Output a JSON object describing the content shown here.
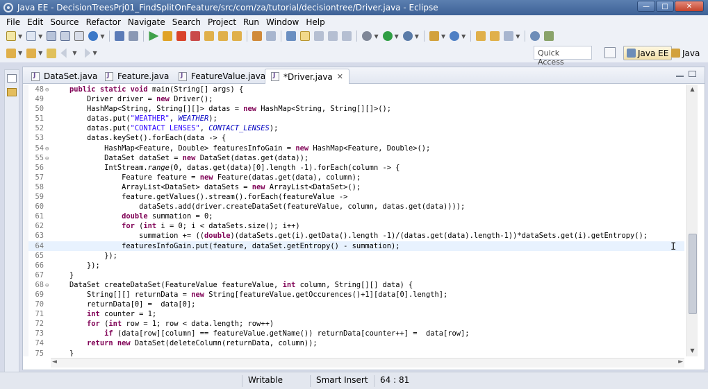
{
  "window": {
    "title": "Java EE - DecisionTreesPrj01_FindSplitOnFeature/src/com/za/tutorial/decisiontree/Driver.java - Eclipse",
    "minimize_label": "—",
    "maximize_label": "□",
    "close_label": "✕"
  },
  "menu": [
    "File",
    "Edit",
    "Source",
    "Refactor",
    "Navigate",
    "Search",
    "Project",
    "Run",
    "Window",
    "Help"
  ],
  "toolbar": {
    "quick_access_label": "Quick Access",
    "perspectives": [
      {
        "label": "Java EE",
        "active": true
      },
      {
        "label": "Java",
        "active": false
      }
    ]
  },
  "editor": {
    "tabs": [
      {
        "label": "DataSet.java",
        "active": false
      },
      {
        "label": "Feature.java",
        "active": false
      },
      {
        "label": "FeatureValue.java",
        "active": false
      },
      {
        "label": "*Driver.java",
        "active": true,
        "close_label": "✕"
      }
    ],
    "current_line": 64,
    "lines": [
      {
        "n": 48,
        "fold": "⊖",
        "code": "    public static void main(String[] args) {"
      },
      {
        "n": 49,
        "code": "        Driver driver = new Driver();"
      },
      {
        "n": 50,
        "code": "        HashMap<String, String[][]> datas = new HashMap<String, String[][]>();"
      },
      {
        "n": 51,
        "code": "        datas.put(\"WEATHER\", WEATHER);"
      },
      {
        "n": 52,
        "code": "        datas.put(\"CONTACT LENSES\", CONTACT_LENSES);"
      },
      {
        "n": 53,
        "code": "        datas.keySet().forEach(data -> {"
      },
      {
        "n": 54,
        "fold": "⊖",
        "code": "            HashMap<Feature, Double> featuresInfoGain = new HashMap<Feature, Double>();"
      },
      {
        "n": 55,
        "fold": "⊖",
        "code": "            DataSet dataSet = new DataSet(datas.get(data));"
      },
      {
        "n": 56,
        "code": "            IntStream.range(0, datas.get(data)[0].length -1).forEach(column -> {"
      },
      {
        "n": 57,
        "code": "                Feature feature = new Feature(datas.get(data), column);"
      },
      {
        "n": 58,
        "code": "                ArrayList<DataSet> dataSets = new ArrayList<DataSet>();"
      },
      {
        "n": 59,
        "code": "                feature.getValues().stream().forEach(featureValue ->"
      },
      {
        "n": 60,
        "code": "                    dataSets.add(driver.createDataSet(featureValue, column, datas.get(data))));"
      },
      {
        "n": 61,
        "code": "                double summation = 0;"
      },
      {
        "n": 62,
        "code": "                for (int i = 0; i < dataSets.size(); i++)"
      },
      {
        "n": 63,
        "code": "                    summation += ((double)(dataSets.get(i).getData().length -1)/(datas.get(data).length-1))*dataSets.get(i).getEntropy();"
      },
      {
        "n": 64,
        "code": "                featuresInfoGain.put(feature, dataSet.getEntropy() - summation);"
      },
      {
        "n": 65,
        "code": "            });"
      },
      {
        "n": 66,
        "code": "        });"
      },
      {
        "n": 67,
        "code": "    }"
      },
      {
        "n": 68,
        "fold": "⊖",
        "code": "    DataSet createDataSet(FeatureValue featureValue, int column, String[][] data) {"
      },
      {
        "n": 69,
        "code": "        String[][] returnData = new String[featureValue.getOccurences()+1][data[0].length];"
      },
      {
        "n": 70,
        "code": "        returnData[0] =  data[0];"
      },
      {
        "n": 71,
        "code": "        int counter = 1;"
      },
      {
        "n": 72,
        "code": "        for (int row = 1; row < data.length; row++)"
      },
      {
        "n": 73,
        "code": "            if (data[row][column] == featureValue.getName()) returnData[counter++] =  data[row];"
      },
      {
        "n": 74,
        "code": "        return new DataSet(deleteColumn(returnData, column));"
      },
      {
        "n": 75,
        "code": "    }"
      }
    ]
  },
  "status": {
    "writable": "Writable",
    "insert_mode": "Smart Insert",
    "position": "64 : 81"
  },
  "colors": {
    "keyword": "#7f0055",
    "string": "#2a00ff",
    "field": "#0000c0",
    "current_line": "#e8f2fe"
  }
}
